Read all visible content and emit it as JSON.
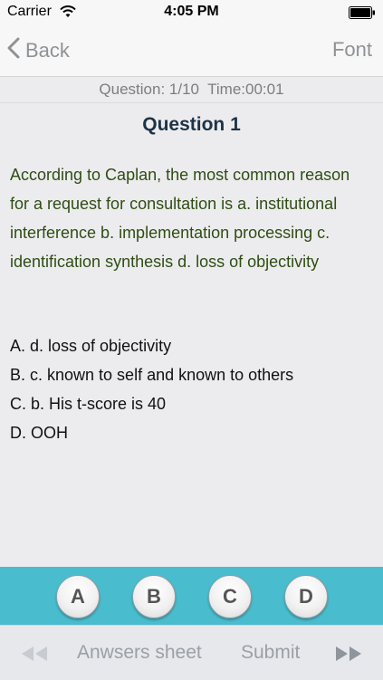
{
  "status": {
    "carrier": "Carrier",
    "time": "4:05 PM",
    "icons": [
      "wifi-icon",
      "battery-icon"
    ]
  },
  "nav": {
    "back_label": "Back",
    "font_label": "Font",
    "icons": [
      "chevron-left-icon"
    ]
  },
  "info": {
    "question_label": "Question: 1/10",
    "time_label": "Time:00:01"
  },
  "question": {
    "title": "Question 1",
    "text": "According to Caplan, the most common reason for a request for consultation is a. institutional interference b. implementation processing c. identification synthesis d. loss of objectivity",
    "options": [
      "A. d. loss of objectivity",
      "B. c. known to self and known to others",
      "C. b. His t-score is 40",
      "D. OOH"
    ]
  },
  "answer_buttons": [
    "A",
    "B",
    "C",
    "D"
  ],
  "bottom": {
    "answers_sheet_label": "Anwsers sheet",
    "submit_label": "Submit",
    "icons": [
      "previous-icon",
      "next-icon"
    ]
  },
  "colors": {
    "nav_text": "#8e9296",
    "question_title": "#1d3347",
    "question_text": "#2f4d13",
    "answer_bar": "#49bccd",
    "content_bg": "#ececee"
  }
}
